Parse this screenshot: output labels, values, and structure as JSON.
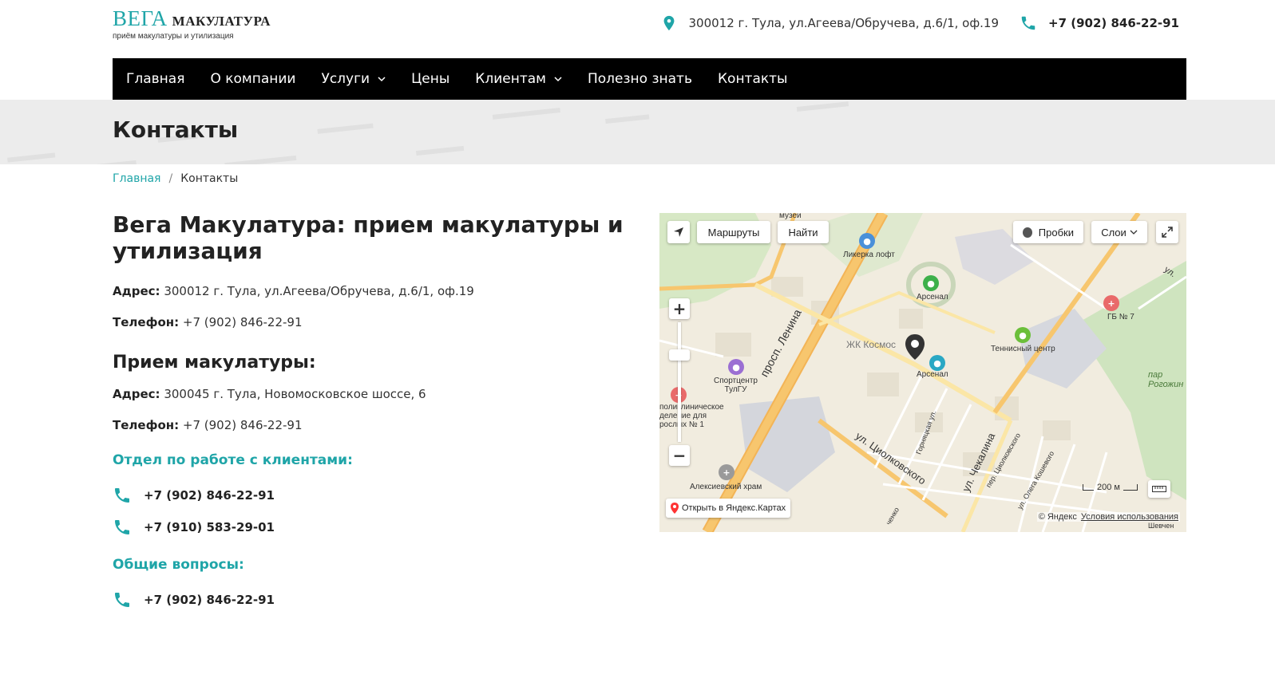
{
  "header": {
    "logo_main": "ВЕГА",
    "logo_secondary": "МАКУЛАТУРА",
    "logo_sub": "приём макулатуры и утилизация",
    "address": "300012 г. Тула, ул.Агеева/Обручева, д.6/1, оф.19",
    "phone": "+7 (902) 846-22-91"
  },
  "nav": {
    "items": [
      {
        "label": "Главная"
      },
      {
        "label": "О компании"
      },
      {
        "label": "Услуги"
      },
      {
        "label": "Цены"
      },
      {
        "label": "Клиентам"
      },
      {
        "label": "Полезно знать"
      },
      {
        "label": "Контакты"
      }
    ]
  },
  "page": {
    "title": "Контакты",
    "breadcrumb_home": "Главная",
    "breadcrumb_sep": "/",
    "breadcrumb_current": "Контакты"
  },
  "content": {
    "company_title": "Вега Макулатура: прием макулатуры и утилизация",
    "address_label": "Адрес:",
    "address": "300012 г. Тула, ул.Агеева/Обручева, д.6/1, оф.19",
    "phone_label": "Телефон:",
    "phone": "+7 (902) 846-22-91",
    "reception_title": "Прием макулатуры:",
    "reception_address_label": "Адрес:",
    "reception_address": "300045 г. Тула, Новомосковское шоссе, 6",
    "reception_phone_label": "Телефон:",
    "reception_phone": "+7 (902) 846-22-91",
    "clients_title": "Отдел по работе с клиентами:",
    "clients_phones": [
      "+7 (902) 846-22-91",
      "+7 (910) 583-29-01"
    ],
    "general_title": "Общие вопросы:",
    "general_phones": [
      "+7 (902) 846-22-91"
    ]
  },
  "map": {
    "routes_button": "Маршруты",
    "find_button": "Найти",
    "traffic_button": "Пробки",
    "layers_button": "Слои",
    "open_yandex": "Открыть в Яндекс.Картах",
    "copyright": "© Яндекс",
    "terms": "Условия использования",
    "scale": "200 м",
    "labels": {
      "museums": "музеи",
      "likerka": "Ликерка лофт",
      "arsenal_stadium": "Арсенал",
      "gb7": "ГБ № 7",
      "tennis": "Теннисный центр",
      "zhk_kosmos": "ЖК Космос",
      "arsenal": "Арсенал",
      "sportcenter": "Спортцентр\nТулГУ",
      "clinic": "поликлиническое\nделение для\nрослых № 1",
      "church": "Алексиевский храм",
      "park": "пар\nРогожин",
      "street_lenina": "просп. Ленина",
      "street_tsiolkovskogo": "ул. Циолковского",
      "street_chekalina": "ул. Чекалина",
      "street_goryatskaya": "Горняцкая ул.",
      "street_per_tsiolk": "пер. Циолковского",
      "street_koshevogo": "ул. Олега Кошевого",
      "street_ul": "ул.",
      "street_chenko": "ченко",
      "street_shevchen": "Шевчен"
    }
  },
  "colors": {
    "accent": "#1fa5a8",
    "nav_bg": "#000000",
    "banner_bg": "#ececec"
  }
}
